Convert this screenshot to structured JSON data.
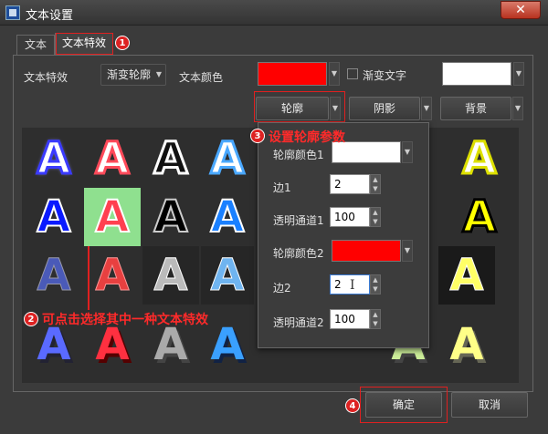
{
  "window": {
    "title": "文本设置",
    "close": "✕"
  },
  "tabs": {
    "text": "文本",
    "effects": "文本特效"
  },
  "controls": {
    "effect_label": "文本特效",
    "effect_value": "渐变轮廓",
    "color_label": "文本颜色",
    "color_value": "#ff0000",
    "gradient_label": "渐变文字",
    "gradient_color": "#ffffff",
    "outline_btn": "轮廓",
    "shadow_btn": "阴影",
    "background_btn": "背景"
  },
  "popup": {
    "outline_color1_label": "轮廓颜色1",
    "outline_color1": "#ffffff",
    "edge1_label": "边1",
    "edge1_value": "2",
    "alpha1_label": "透明通道1",
    "alpha1_value": "100",
    "outline_color2_label": "轮廓颜色2",
    "outline_color2": "#ff0000",
    "edge2_label": "边2",
    "edge2_value": "2",
    "alpha2_label": "透明通道2",
    "alpha2_value": "100"
  },
  "gallery": {
    "glyph": "A"
  },
  "annotations": {
    "b1": "1",
    "b2": "2",
    "b3": "3",
    "b4": "4",
    "caption3": "设置轮廓参数",
    "caption2": "可点击选择其中一种文本特效"
  },
  "footer": {
    "ok": "确定",
    "cancel": "取消"
  }
}
